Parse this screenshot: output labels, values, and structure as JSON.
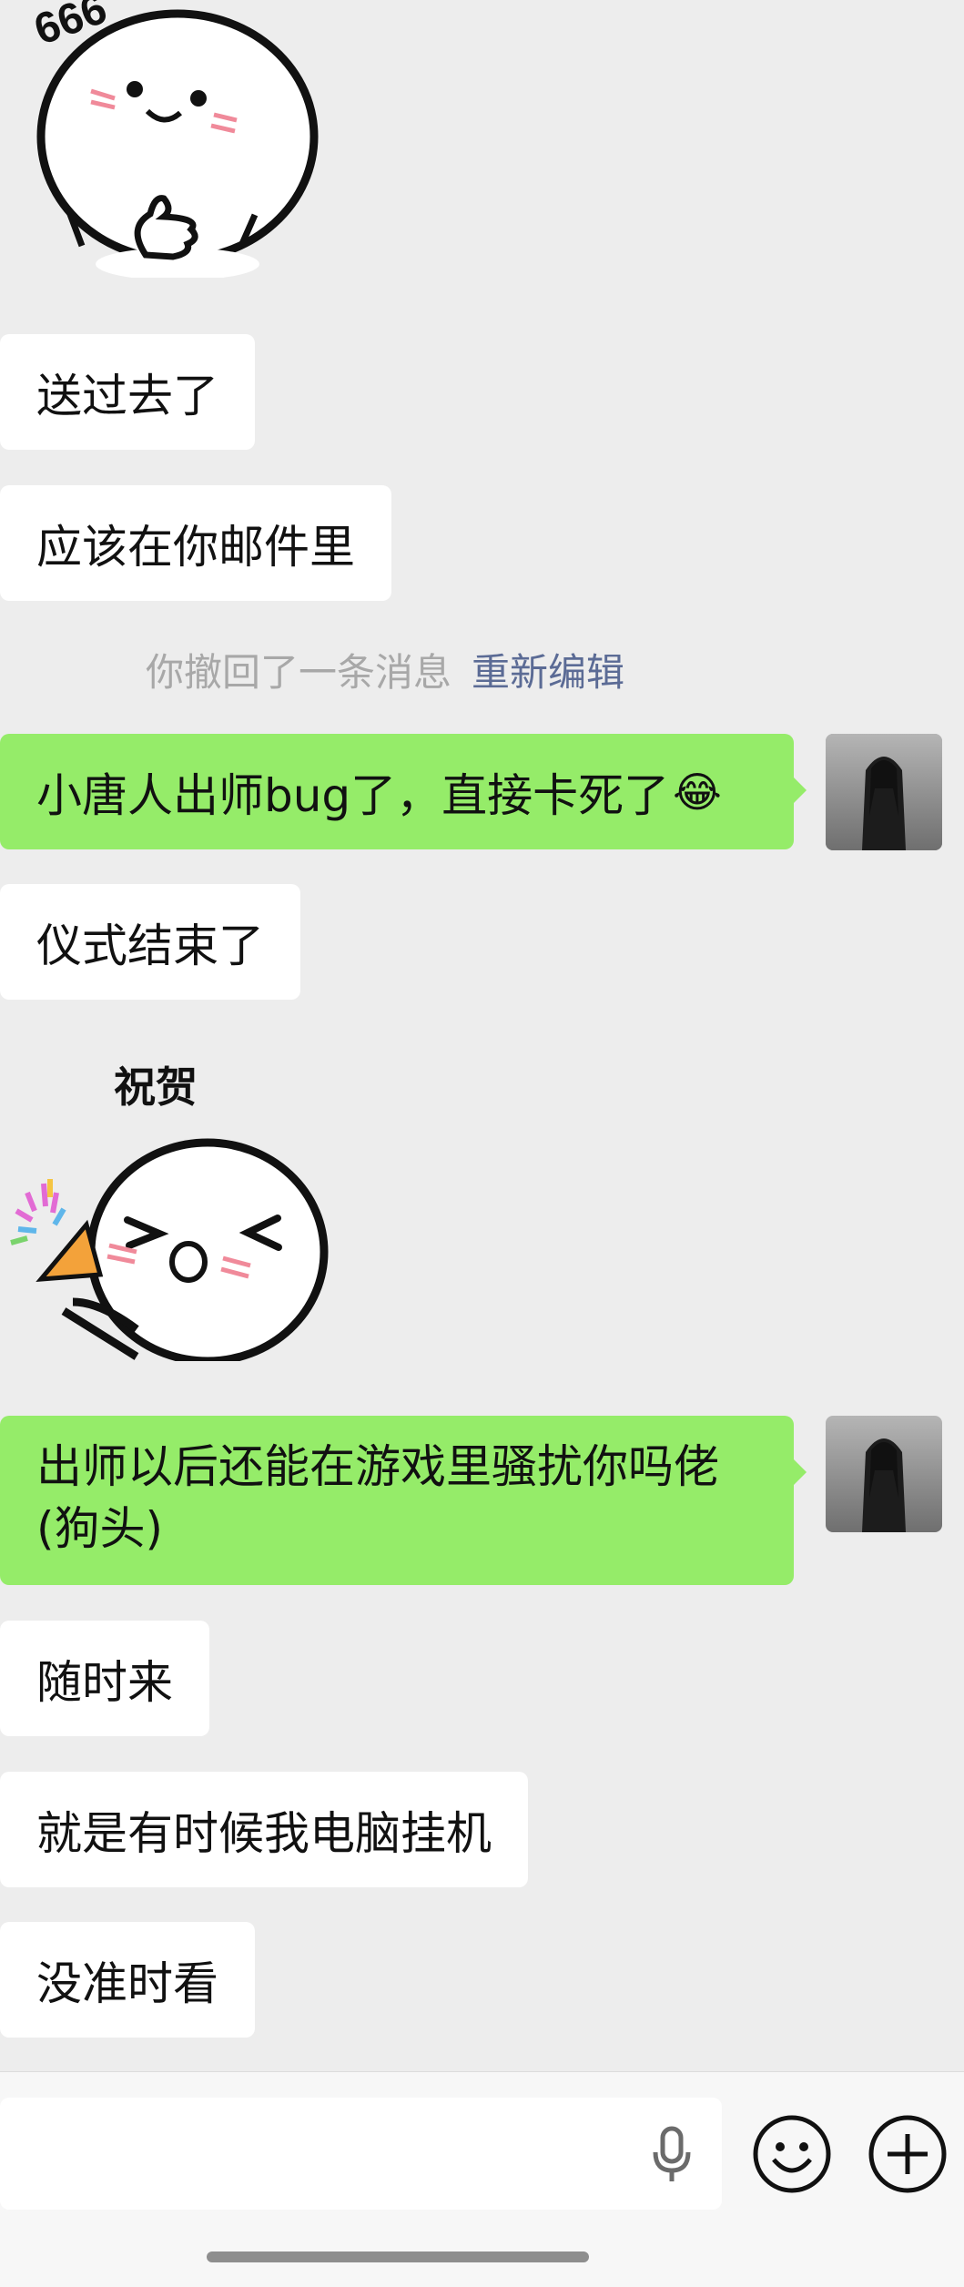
{
  "messages": {
    "m1": "送过去了",
    "m2": "应该在你邮件里",
    "recall": {
      "text": "你撤回了一条消息",
      "action": "重新编辑"
    },
    "m3": "小唐人出师bug了，直接卡死了",
    "m4": "仪式结束了",
    "m5": "出师以后还能在游戏里骚扰你吗佬(狗头)",
    "m6": "随时来",
    "m7": "就是有时候我电脑挂机",
    "m8": "没准时看"
  },
  "stickers": {
    "top": {
      "text": "666"
    },
    "congrats": {
      "text": "祝贺"
    }
  },
  "emoji": {
    "laugh_cry": "😂"
  },
  "input": {
    "value": "",
    "icons": [
      "microphone-icon",
      "emoji-icon",
      "plus-icon"
    ]
  },
  "colors": {
    "background": "#ededed",
    "incoming_bubble": "#ffffff",
    "outgoing_bubble": "#95ec69",
    "system_text": "#a8a8a8",
    "relink_text": "#5b6b95"
  }
}
